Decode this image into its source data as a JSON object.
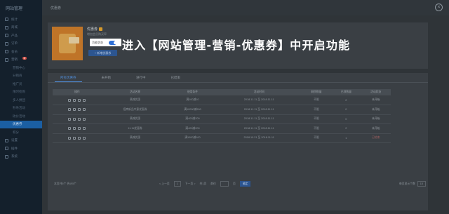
{
  "sidebar": {
    "logo": "网站管理",
    "items": [
      {
        "label": "统计",
        "sub": false
      },
      {
        "label": "商城",
        "sub": false
      },
      {
        "label": "产品",
        "sub": false
      },
      {
        "label": "订单",
        "sub": false
      },
      {
        "label": "会员",
        "sub": false
      },
      {
        "label": "营销",
        "sub": false,
        "badge": "新"
      },
      {
        "label": "营销中心",
        "sub": true
      },
      {
        "label": "分销商",
        "sub": true
      },
      {
        "label": "推广员",
        "sub": true
      },
      {
        "label": "限时抢购",
        "sub": true
      },
      {
        "label": "多人拼团",
        "sub": true
      },
      {
        "label": "秒杀活动",
        "sub": true
      },
      {
        "label": "砍价活动",
        "sub": true
      },
      {
        "label": "优惠券",
        "sub": true,
        "active": true
      },
      {
        "label": "积分",
        "sub": true
      },
      {
        "label": "设置",
        "sub": false
      },
      {
        "label": "插件",
        "sub": false
      },
      {
        "label": "系统",
        "sub": false
      }
    ]
  },
  "header": {
    "title": "优惠券",
    "close_icon": "close-icon"
  },
  "app": {
    "title": "优惠券",
    "desc": "增加会员购买率",
    "toggle_label": "功能状态",
    "toggle_on": true,
    "add_button": "+ 新增优惠券"
  },
  "overlay": "进入【网站管理-营销-优惠券】中开启功能",
  "tabs": [
    "所有优惠券",
    "未开始",
    "进行中",
    "已结束"
  ],
  "table": {
    "headers": [
      "操作",
      "活动名称",
      "使用条件",
      "活动时间",
      "剩余数量",
      "已领数量",
      "活动状态"
    ],
    "rows": [
      [
        "满减优惠",
        "满100减10",
        "2018.11.11 至 2018.11.11",
        "不限",
        "2",
        "未开始"
      ],
      [
        "招商新品中意优惠券",
        "满10000减500",
        "2018.11.11 至 2018.11.11",
        "不限",
        "0",
        "未开始"
      ],
      [
        "满减优惠",
        "满400减200",
        "2018.11.11 至 2018.11.11",
        "不限",
        "0",
        "未开始"
      ],
      [
        "11.11优惠券",
        "满400减200",
        "2018.11.11 至 2018.11.11",
        "不限",
        "2",
        "未开始"
      ],
      [
        "满减优惠",
        "满1000减100",
        "2018.10.21 至 2018.11.11",
        "不限",
        "1",
        "已结束"
      ]
    ]
  },
  "footer": {
    "left": "本页共5个  合计5个",
    "prev": "< 上一页",
    "page": "1",
    "next": "下一页 >",
    "total": "共1页",
    "goto": "前往",
    "page_unit": "页",
    "confirm": "确定",
    "per_page_label": "每页显示个数",
    "per_page": "15"
  }
}
